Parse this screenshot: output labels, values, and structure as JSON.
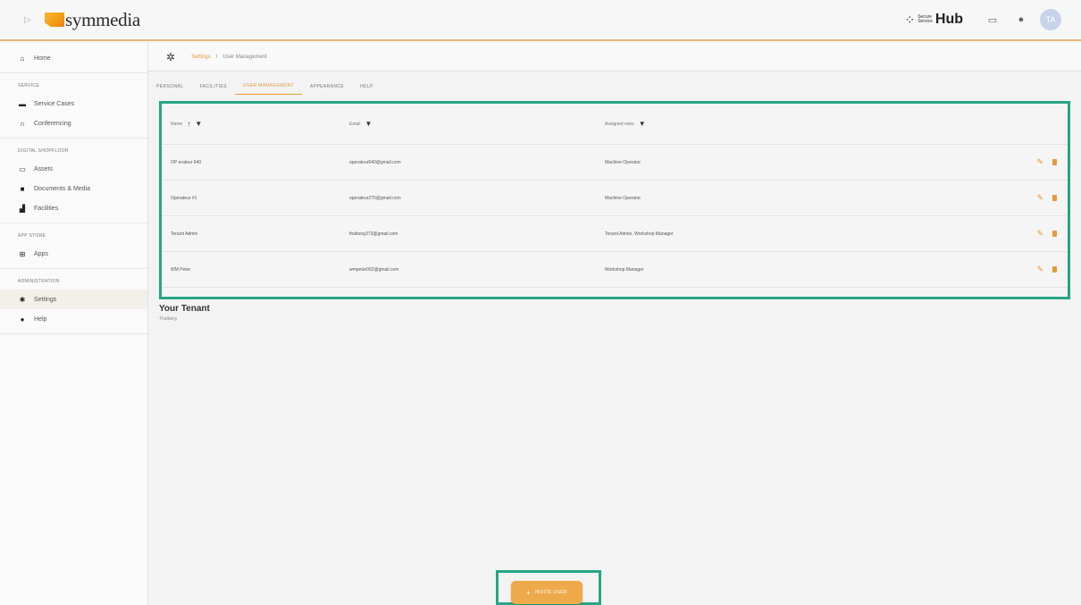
{
  "topbar": {
    "brand": "symmedia",
    "hub_label": "Hub",
    "hub_small_top": "Secure",
    "hub_small_bottom": "Service",
    "avatar_initials": "TA"
  },
  "sidebar": {
    "home": "Home",
    "sections": [
      {
        "label": "SERVICE",
        "items": [
          "Service Cases",
          "Conferencing"
        ]
      },
      {
        "label": "DIGITAL SHOPFLOOR",
        "items": [
          "Assets",
          "Documents & Media",
          "Facilities"
        ]
      },
      {
        "label": "APP STORE",
        "items": [
          "Apps"
        ]
      },
      {
        "label": "ADMINISTRATION",
        "items": [
          "Settings",
          "Help"
        ]
      }
    ]
  },
  "breadcrumb": {
    "parent": "Settings",
    "separator": "/",
    "current": "User Management"
  },
  "tabs": [
    "PERSONAL",
    "FACILITIES",
    "USER MANAGEMENT",
    "APPEARANCE",
    "HELP"
  ],
  "table": {
    "headers": {
      "name": "Name",
      "email": "Email",
      "roles": "Assigned roles"
    },
    "rows": [
      {
        "name": "OP erateur 640",
        "email": "operateur640@gmail.com",
        "roles": "Machine Operator"
      },
      {
        "name": "Operateur #1",
        "email": "operateur275@gmail.com",
        "roles": "Machine Operator"
      },
      {
        "name": "Tenant Admin",
        "email": "thalberg373@gmail.com",
        "roles": "Tenant Admin, Workshop Manager"
      },
      {
        "name": "WM Peter",
        "email": "wmpeter002@gmail.com",
        "roles": "Workshop Manager"
      }
    ]
  },
  "tenant": {
    "title": "Your Tenant",
    "name": "Thalberg"
  },
  "invite_button": "INVITE USER",
  "colors": {
    "accent": "#e49a3a",
    "highlight": "#26a584"
  }
}
